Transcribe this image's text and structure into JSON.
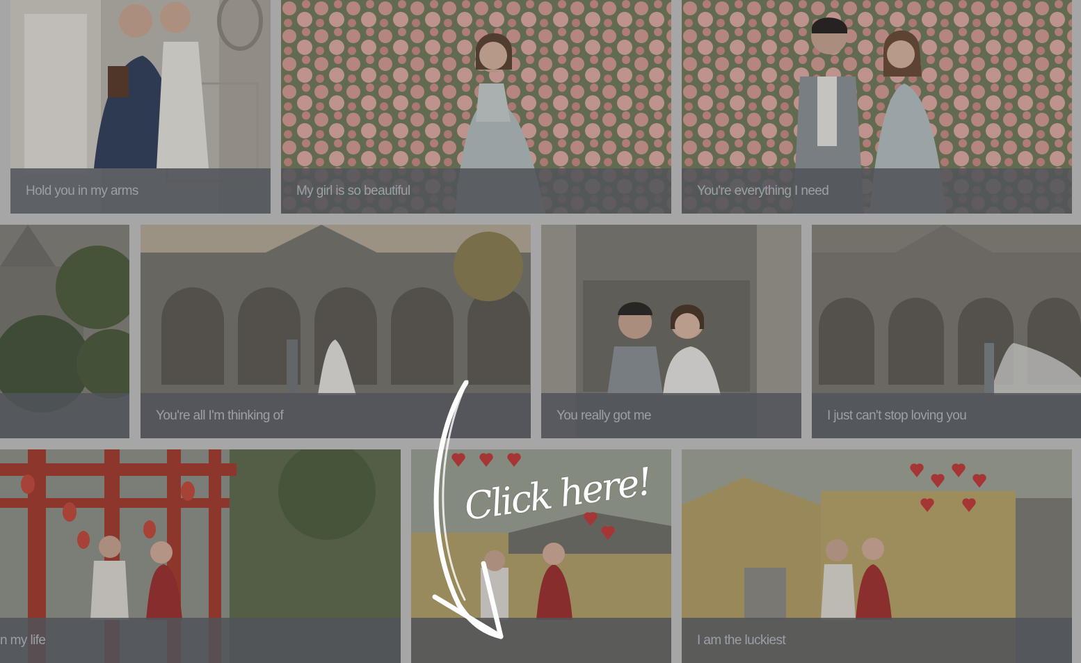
{
  "gallery": {
    "items": [
      {
        "caption": "Hold you in my arms"
      },
      {
        "caption": "My girl is so beautiful"
      },
      {
        "caption": "You're everything I need"
      },
      {
        "caption": ""
      },
      {
        "caption": "You're all I'm thinking of"
      },
      {
        "caption": "You really got me"
      },
      {
        "caption": "I just can't stop loving you"
      },
      {
        "caption": "n my life"
      },
      {
        "caption": ""
      },
      {
        "caption": "I am the luckiest"
      }
    ]
  },
  "hint": {
    "text": "Click here!",
    "arrow_icon": "curved-arrow-icon"
  },
  "colors": {
    "page_background": "#a6a6a6",
    "caption_bar": "#50545a",
    "caption_text": "#9aa0a6",
    "hint_text": "#ffffff"
  }
}
